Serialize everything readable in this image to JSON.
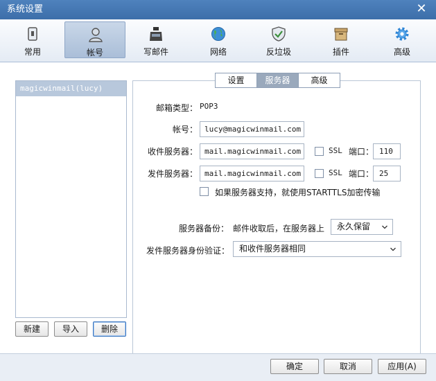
{
  "window": {
    "title": "系统设置"
  },
  "toolbar": {
    "items": [
      {
        "label": "常用",
        "icon": "phone-icon"
      },
      {
        "label": "帐号",
        "icon": "user-icon"
      },
      {
        "label": "写邮件",
        "icon": "inkwell-icon"
      },
      {
        "label": "网络",
        "icon": "globe-icon"
      },
      {
        "label": "反垃圾",
        "icon": "shield-icon"
      },
      {
        "label": "插件",
        "icon": "box-icon"
      },
      {
        "label": "高级",
        "icon": "gear-icon"
      }
    ],
    "active": "帐号"
  },
  "accounts": {
    "items": [
      "magicwinmail(lucy)"
    ],
    "buttons": {
      "new": "新建",
      "import": "导入",
      "delete": "删除"
    }
  },
  "tabs": {
    "items": [
      "设置",
      "服务器",
      "高级"
    ],
    "active": "服务器"
  },
  "form": {
    "mailbox_type_label": "邮箱类型：",
    "mailbox_type_value": "POP3",
    "account_label": "帐号：",
    "account_value": "lucy@magicwinmail.com",
    "incoming_label": "收件服务器：",
    "incoming_value": "mail.magicwinmail.com",
    "incoming_ssl": "SSL",
    "incoming_port_label": "端口：",
    "incoming_port": "110",
    "outgoing_label": "发件服务器：",
    "outgoing_value": "mail.magicwinmail.com",
    "outgoing_ssl": "SSL",
    "outgoing_port_label": "端口：",
    "outgoing_port": "25",
    "starttls_label": "如果服务器支持，就使用STARTTLS加密传输",
    "backup_label": "服务器备份：",
    "backup_text": "邮件收取后，在服务器上",
    "backup_option": "永久保留",
    "auth_label": "发件服务器身份验证：",
    "auth_option": "和收件服务器相同"
  },
  "footer": {
    "ok": "确定",
    "cancel": "取消",
    "apply": "应用(A)"
  },
  "colors": {
    "titlebar": "#4074b0",
    "selection": "#b8c8dc",
    "tab_active": "#9aa9bc"
  }
}
